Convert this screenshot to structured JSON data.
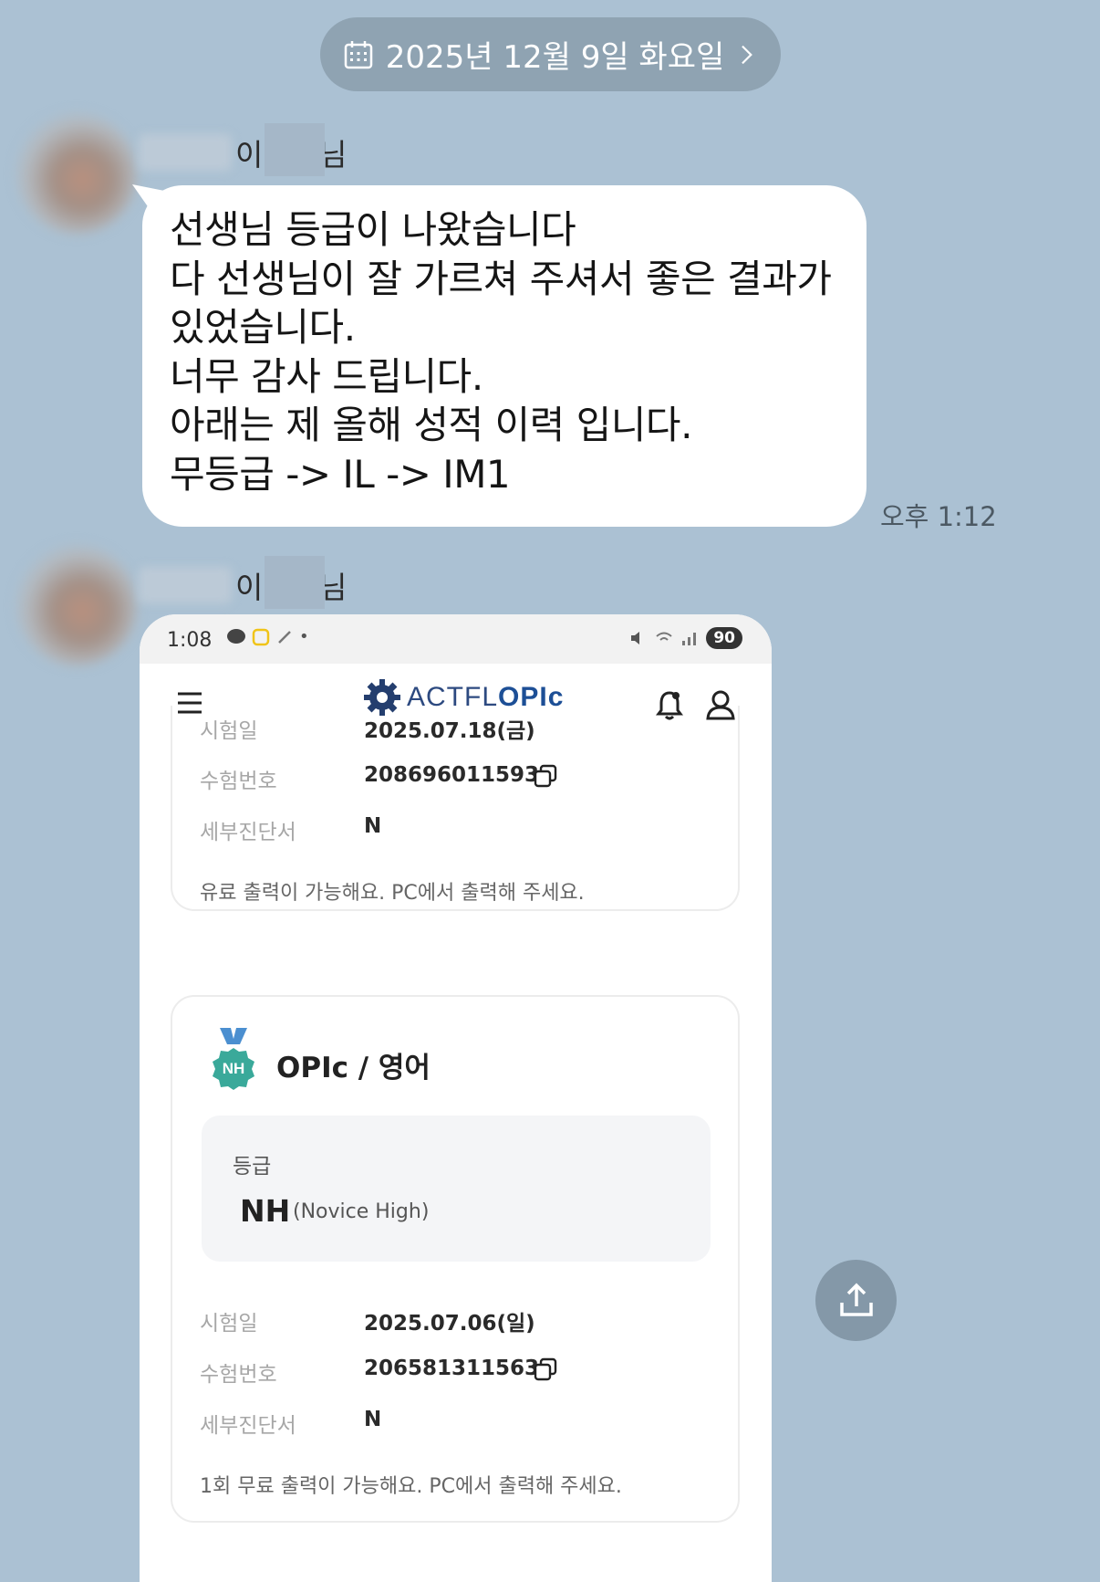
{
  "date_divider": {
    "label": "2025년 12월 9일 화요일"
  },
  "messages": [
    {
      "sender_part1": "이",
      "sender_part2": "님",
      "lines": [
        "선생님 등급이 나왔습니다",
        "다 선생님이 잘 가르쳐 주셔서 좋은 결과가",
        "있었습니다.",
        "너무 감사 드립니다.",
        "아래는 제 올해 성적 이력 입니다.",
        "무등급 -> IL -> IM1"
      ],
      "time": "오후 1:12"
    },
    {
      "sender_part1": "이",
      "sender_part2": "님"
    }
  ],
  "screenshot": {
    "statusbar": {
      "clock": "1:08",
      "battery": "90"
    },
    "logo": {
      "prefix": "ACTFL",
      "suffix": "OPIc"
    },
    "card1": {
      "rows": [
        {
          "label": "시험일",
          "value": "2025.07.18(금)"
        },
        {
          "label": "수험번호",
          "value": "208696011593"
        },
        {
          "label": "세부진단서",
          "value": "N"
        }
      ],
      "note": "유료 출력이 가능해요. PC에서 출력해 주세요."
    },
    "card2": {
      "badge": "NH",
      "title": "OPIc / 영어",
      "grade_label": "등급",
      "grade_code": "NH",
      "grade_desc": "(Novice High)",
      "rows": [
        {
          "label": "시험일",
          "value": "2025.07.06(일)"
        },
        {
          "label": "수험번호",
          "value": "206581311563"
        },
        {
          "label": "세부진단서",
          "value": "N"
        }
      ],
      "note": "1회 무료 출력이 가능해요. PC에서 출력해 주세요."
    }
  },
  "colors": {
    "chat_background": "#abc1d3",
    "date_pill": "#8fa3b2",
    "badge_teal": "#3aa99a",
    "share_button": "#8498a8"
  },
  "icons": [
    "calendar-icon",
    "chevron-right-icon",
    "menu-icon",
    "bell-icon",
    "user-icon",
    "copy-icon",
    "medal-icon",
    "share-icon"
  ]
}
